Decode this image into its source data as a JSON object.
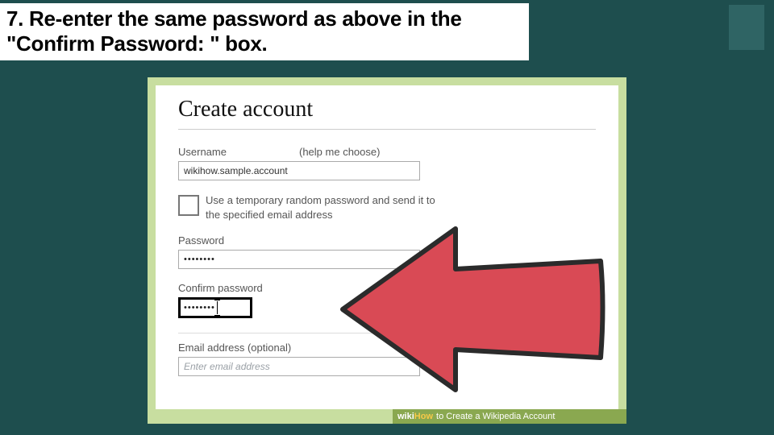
{
  "slide": {
    "step_number": "7.",
    "title_line1": "7. Re-enter the same password as above in the",
    "title_line2": "\"Confirm Password: \" box."
  },
  "form": {
    "heading": "Create account",
    "username_label": "Username",
    "help_me_choose": "(help me choose)",
    "username_value": "wikihow.sample.account",
    "temp_pw_text": "Use a temporary random password and send it to the specified email address",
    "password_label": "Password",
    "password_value": "••••••••",
    "confirm_label": "Confirm password",
    "confirm_value": "••••••••",
    "email_label": "Email address (optional)",
    "email_placeholder": "Enter email address"
  },
  "footer": {
    "brand_a": "wiki",
    "brand_b": "How",
    "tagline": " to Create a Wikipedia Account"
  },
  "colors": {
    "slide_bg": "#1e4e4e",
    "figure_bg": "#c8dea0",
    "arrow_fill": "#d94a55",
    "arrow_stroke": "#2b2b2b",
    "footer_bg": "#8aa850",
    "how_color": "#f7c948"
  }
}
